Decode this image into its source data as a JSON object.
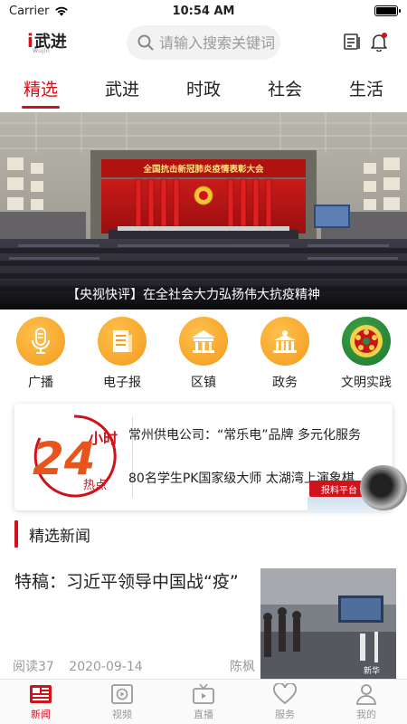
{
  "status_bar": {
    "carrier": "Carrier",
    "time": "10:54 AM",
    "battery_level": 1.0
  },
  "header": {
    "logo_prefix": "i",
    "logo_text": "武进",
    "logo_sub": "Wujin",
    "search_placeholder": "请输入搜索关键词"
  },
  "tabs": [
    {
      "label": "精选",
      "active": true
    },
    {
      "label": "武进",
      "active": false
    },
    {
      "label": "时政",
      "active": false
    },
    {
      "label": "社会",
      "active": false
    },
    {
      "label": "生活",
      "active": false
    }
  ],
  "banner": {
    "hall_banner": "全国抗击新冠肺炎疫情表彰大会",
    "caption": "【央视快评】在全社会大力弘扬伟大抗疫精神"
  },
  "quick_menu": [
    {
      "label": "广播",
      "icon": "microphone-icon"
    },
    {
      "label": "电子报",
      "icon": "newspaper-icon"
    },
    {
      "label": "区镇",
      "icon": "building-icon"
    },
    {
      "label": "政务",
      "icon": "government-icon"
    },
    {
      "label": "文明实践",
      "icon": "civilization-icon"
    }
  ],
  "hot_news": {
    "logo_number": "24",
    "logo_top": "小时",
    "logo_bottom": "热点",
    "items": [
      "常州供电公司：“常乐电”品牌 多元化服务",
      "80名学生PK国家级大师 太湖湾上演象棋..."
    ]
  },
  "floating_button": {
    "label": "报料平台"
  },
  "section": {
    "title": "精选新闻"
  },
  "article": {
    "title": "特稿：习近平领导中国战“疫”",
    "reads": "阅读37",
    "date": "2020-09-14",
    "author": "陈枫",
    "thumb_watermark": "新华"
  },
  "tab_bar": [
    {
      "label": "新闻",
      "icon": "news-icon",
      "active": true
    },
    {
      "label": "视频",
      "icon": "video-icon",
      "active": false
    },
    {
      "label": "直播",
      "icon": "live-tv-icon",
      "active": false
    },
    {
      "label": "服务",
      "icon": "heart-icon",
      "active": false
    },
    {
      "label": "我的",
      "icon": "user-icon",
      "active": false
    }
  ],
  "colors": {
    "accent": "#d0121b",
    "orange": "#f5a623",
    "green": "#22853a"
  }
}
